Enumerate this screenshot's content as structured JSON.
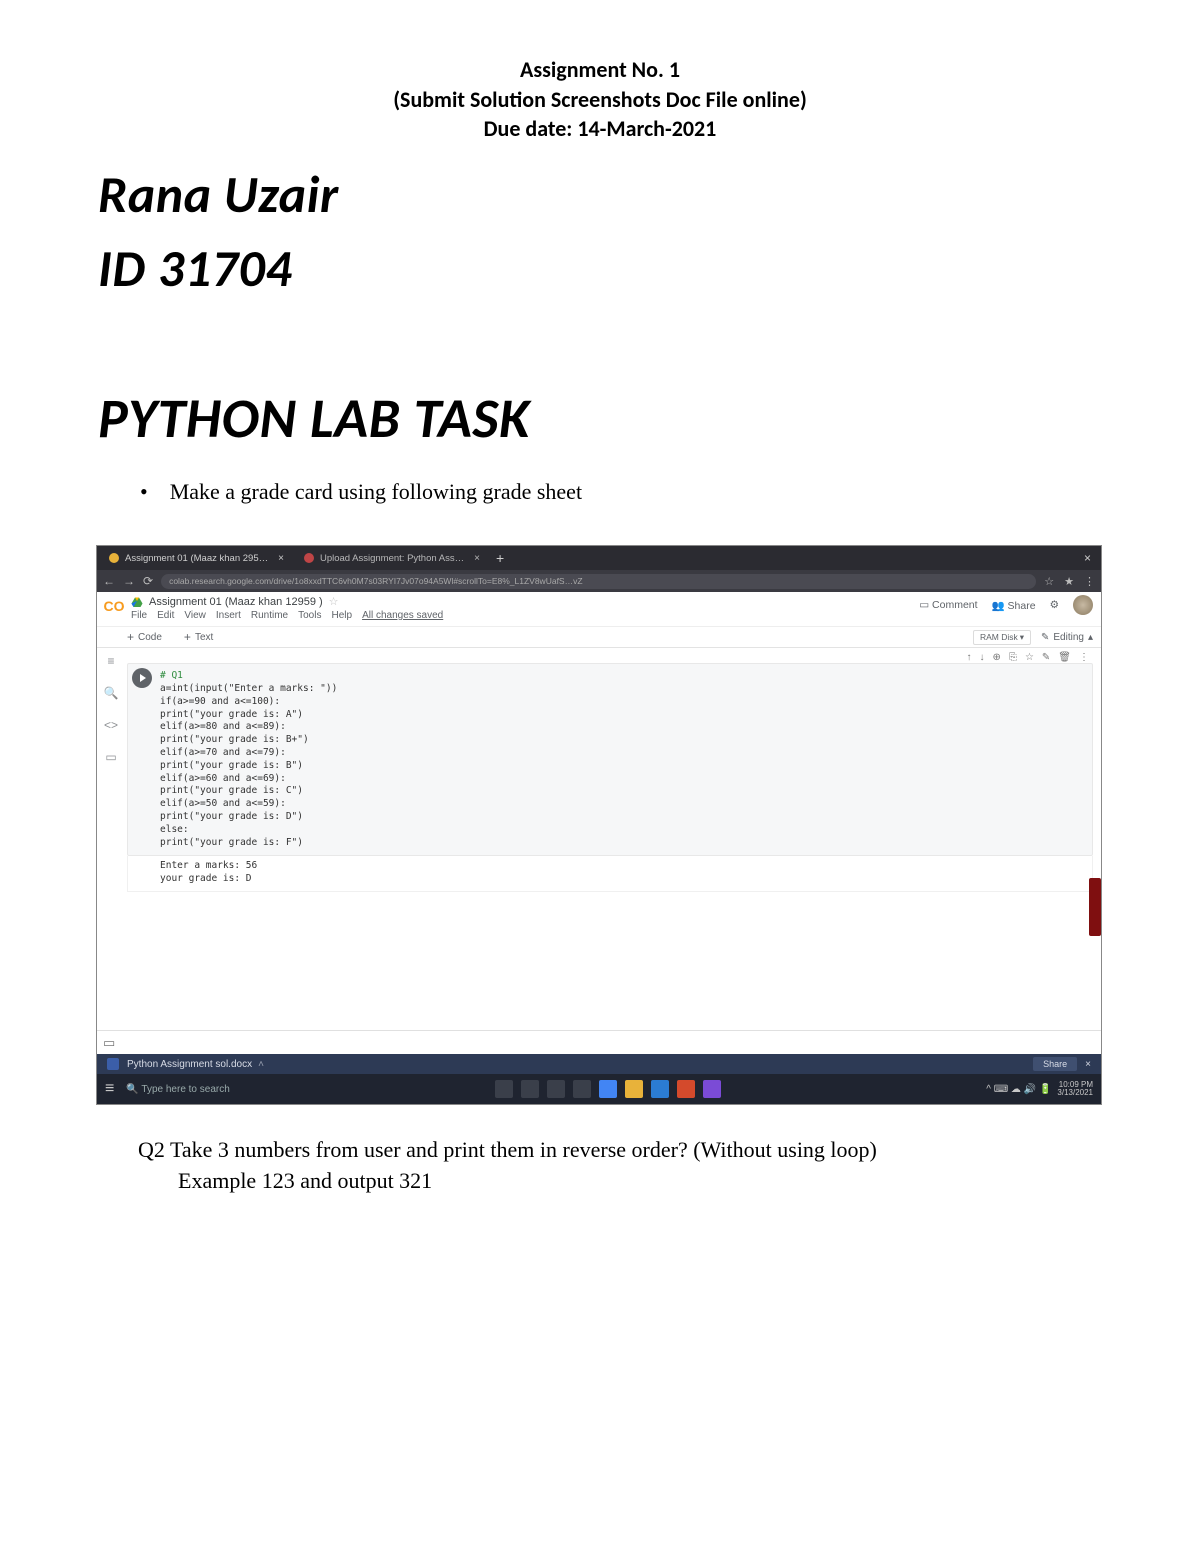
{
  "header": {
    "l1": "Assignment No. 1",
    "l2": "(Submit Solution Screenshots Doc File online)",
    "l3": "Due date: 14-March-2021"
  },
  "student": {
    "name": "Rana Uzair",
    "id_line": "ID    31704"
  },
  "lab_title": "PYTHON LAB TASK",
  "q1_bullet": "Make a grade card using following grade sheet",
  "q2": {
    "line1": "Q2  Take 3 numbers from user and print them in reverse order? (Without using loop)",
    "line2": "Example 123 and output 321"
  },
  "browser": {
    "tabs": [
      {
        "icon": "orange",
        "label": "Assignment 01 (Maaz khan 295…",
        "close": "×"
      },
      {
        "icon": "red",
        "label": "Upload Assignment: Python Ass…",
        "close": "×"
      }
    ],
    "win_close": "×",
    "nav": {
      "back": "←",
      "fwd": "→",
      "reload": "⟳"
    },
    "url": "colab.research.google.com/drive/1o8xxdTTC6vh0M7s03RYI7Jv07o94A5Wl#scrollTo=E8%_L1ZV8wUafS…vZ",
    "right_icons": [
      "☆",
      "★",
      "⋮"
    ]
  },
  "colab": {
    "filename": "Assignment 01 (Maaz khan 12959 )",
    "star": "☆",
    "menu": [
      "File",
      "Edit",
      "View",
      "Insert",
      "Runtime",
      "Tools",
      "Help"
    ],
    "saved": "All changes saved",
    "top_right": {
      "comment": "Comment",
      "share": "Share",
      "gear": "⚙"
    },
    "toolbar": {
      "code": "Code",
      "text": "Text",
      "conn": "RAM  Disk",
      "editing": "Editing"
    },
    "leftrail": [
      "≡",
      "🔍",
      "<>",
      "▭"
    ],
    "cell_toolbar": [
      "↑",
      "↓",
      "⊕",
      "⎘",
      "☆",
      "✎",
      "🗑",
      "⋮"
    ],
    "code_lines": [
      "# Q1",
      "a=int(input(\"Enter a marks: \"))",
      "if(a>=90 and a<=100):",
      "    print(\"your grade is: A\")",
      "elif(a>=80 and a<=89):",
      "    print(\"your grade is: B+\")",
      "elif(a>=70 and a<=79):",
      "    print(\"your grade is: B\")",
      "elif(a>=60 and a<=69):",
      "    print(\"your grade is: C\")",
      "elif(a>=50 and a<=59):",
      "    print(\"your grade is: D\")",
      "else:",
      "    print(\"your grade is: F\")"
    ],
    "output_lines": [
      "Enter a marks: 56",
      "your grade is: D"
    ]
  },
  "wordbar": {
    "file": "Python Assignment sol.docx",
    "share": "Share",
    "close": "×"
  },
  "taskbar": {
    "search": "Type here to search",
    "icons": [
      {
        "bg": "#3a3f4a"
      },
      {
        "bg": "#3a3f4a"
      },
      {
        "bg": "#3a3f4a"
      },
      {
        "bg": "#3a3f4a"
      },
      {
        "bg": "#4285f4"
      },
      {
        "bg": "#e8b23a"
      },
      {
        "bg": "#2b7cd3"
      },
      {
        "bg": "#d44a2c"
      },
      {
        "bg": "#7b4bd6"
      }
    ],
    "sys_icons": "^ ⌨ ☁ 🔊 🔋",
    "time": "10:09 PM",
    "date": "3/13/2021"
  }
}
